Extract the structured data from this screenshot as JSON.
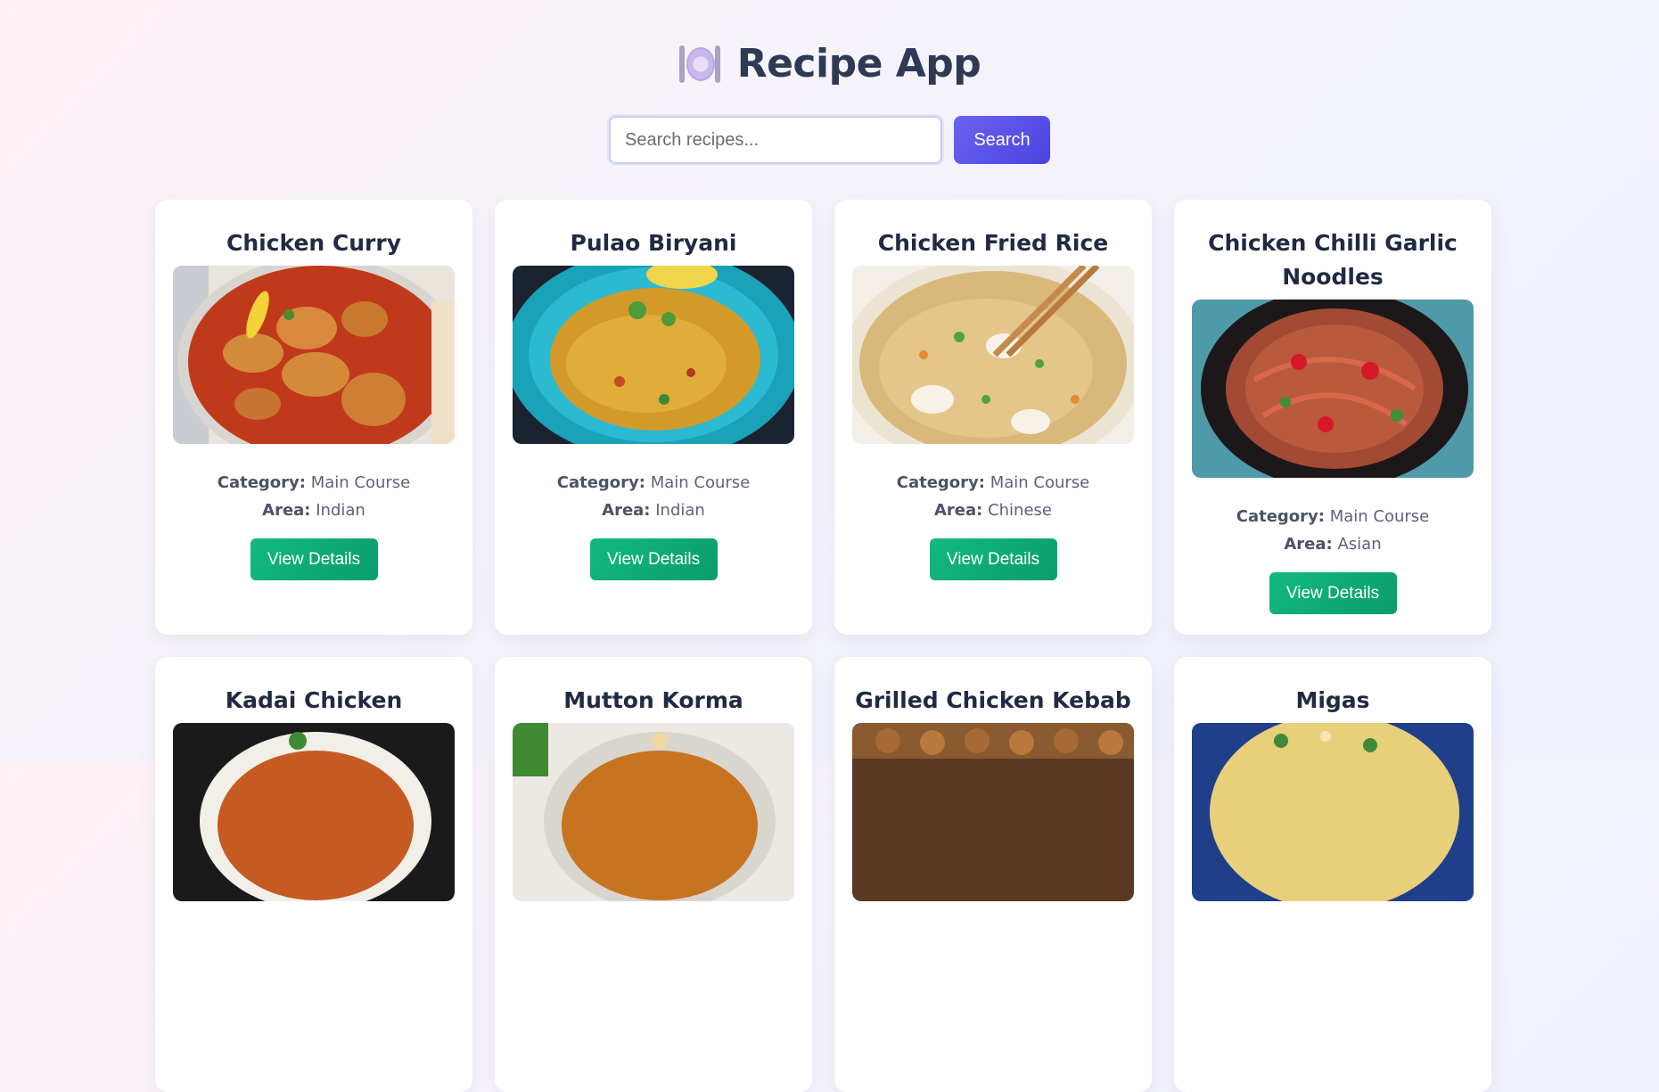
{
  "app": {
    "title": "Recipe App",
    "logo_icon": "plate-fork-knife-icon"
  },
  "search": {
    "placeholder": "Search recipes...",
    "value": "",
    "button_label": "Search"
  },
  "labels": {
    "category": "Category:",
    "area": "Area:",
    "view_details": "View Details"
  },
  "recipes": [
    {
      "name": "Chicken Curry",
      "category": "Main Course",
      "area": "Indian",
      "image": "chicken-curry-photo"
    },
    {
      "name": "Pulao Biryani",
      "category": "Main Course",
      "area": "Indian",
      "image": "pulao-biryani-photo"
    },
    {
      "name": "Chicken Fried Rice",
      "category": "Main Course",
      "area": "Chinese",
      "image": "chicken-fried-rice-photo"
    },
    {
      "name": "Chicken Chilli Garlic Noodles",
      "category": "Main Course",
      "area": "Asian",
      "image": "chilli-garlic-noodles-photo"
    },
    {
      "name": "Kadai Chicken",
      "image": "kadai-chicken-photo"
    },
    {
      "name": "Mutton Korma",
      "image": "mutton-korma-photo"
    },
    {
      "name": "Grilled Chicken Kebab",
      "image": "grilled-chicken-kebab-photo"
    },
    {
      "name": "Migas",
      "image": "migas-photo"
    }
  ],
  "colors": {
    "accent": "#5a52ea",
    "button_green": "#10b07b",
    "title": "#2e3a55"
  }
}
